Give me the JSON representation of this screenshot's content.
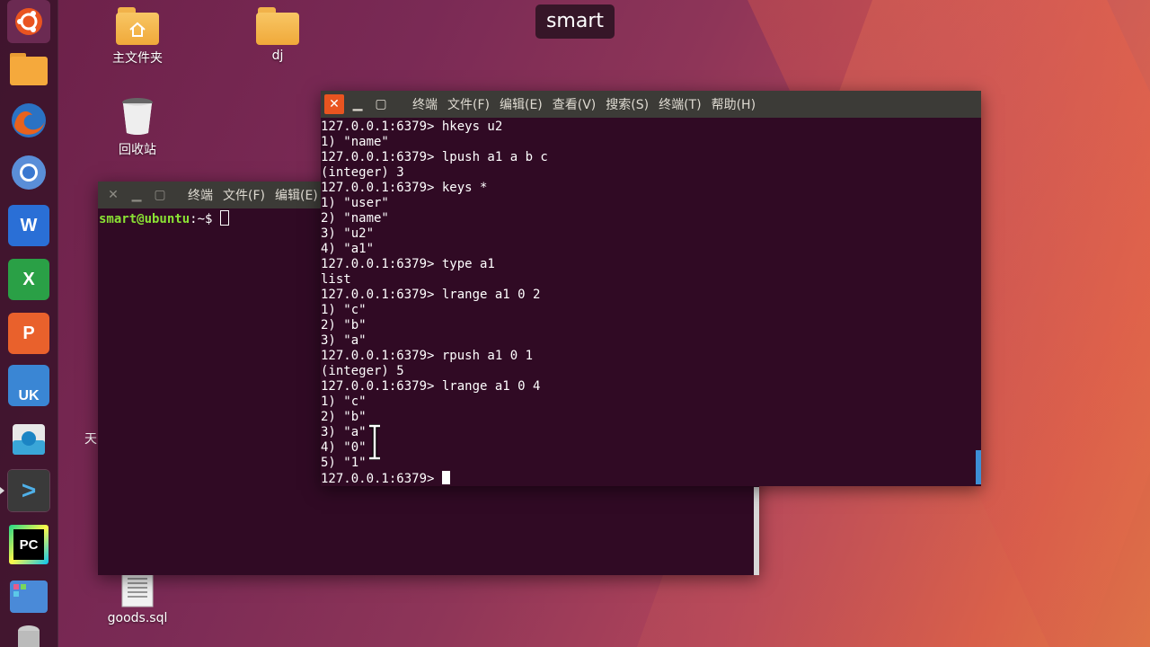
{
  "desktop": {
    "icons": [
      {
        "label": "主文件夹"
      },
      {
        "label": "dj"
      },
      {
        "label": "回收站"
      },
      {
        "label": "goods.sql"
      }
    ],
    "partial_label": "天"
  },
  "hud": {
    "text": "smart"
  },
  "launcher": {
    "items": [
      {
        "name": "ubuntu-logo"
      },
      {
        "name": "files"
      },
      {
        "name": "firefox"
      },
      {
        "name": "chromium"
      },
      {
        "name": "wps-writer",
        "label": "W"
      },
      {
        "name": "wps-spreadsheet",
        "label": "X"
      },
      {
        "name": "wps-presentation",
        "label": "P"
      },
      {
        "name": "ubuntu-software",
        "label": "UK"
      },
      {
        "name": "installer"
      },
      {
        "name": "terminal",
        "label": ">"
      },
      {
        "name": "pycharm",
        "label": "PC"
      },
      {
        "name": "workspace-switcher"
      },
      {
        "name": "disk"
      }
    ]
  },
  "back_terminal": {
    "menu": [
      "终端",
      "文件(F)",
      "编辑(E)"
    ],
    "prompt_user": "smart@ubuntu",
    "prompt_rest": ":~$ "
  },
  "front_terminal": {
    "menu": [
      "终端",
      "文件(F)",
      "编辑(E)",
      "查看(V)",
      "搜索(S)",
      "终端(T)",
      "帮助(H)"
    ],
    "lines": [
      "127.0.0.1:6379> hkeys u2",
      "1) \"name\"",
      "127.0.0.1:6379> lpush a1 a b c",
      "(integer) 3",
      "127.0.0.1:6379> keys *",
      "1) \"user\"",
      "2) \"name\"",
      "3) \"u2\"",
      "4) \"a1\"",
      "127.0.0.1:6379> type a1",
      "list",
      "127.0.0.1:6379> lrange a1 0 2",
      "1) \"c\"",
      "2) \"b\"",
      "3) \"a\"",
      "127.0.0.1:6379> rpush a1 0 1",
      "(integer) 5",
      "127.0.0.1:6379> lrange a1 0 4",
      "1) \"c\"",
      "2) \"b\"",
      "3) \"a\"",
      "4) \"0\"",
      "5) \"1\""
    ],
    "prompt": "127.0.0.1:6379> "
  }
}
